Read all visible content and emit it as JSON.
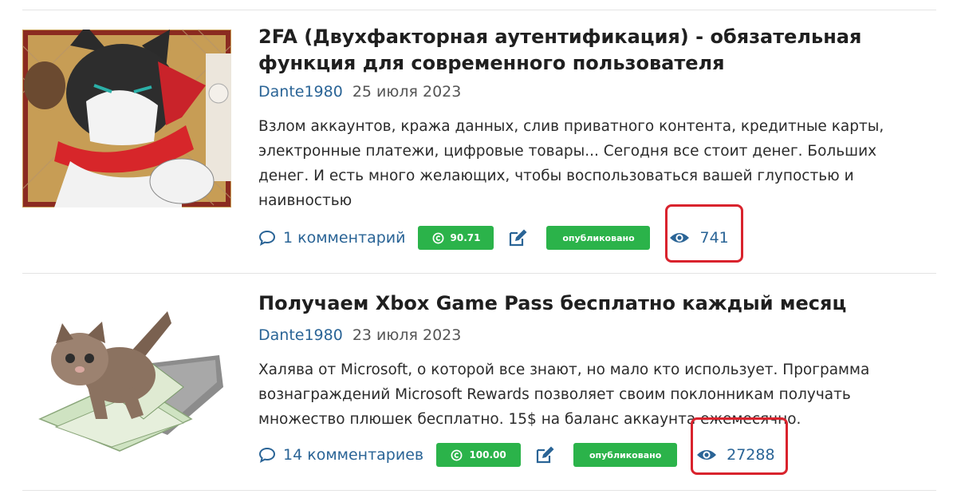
{
  "articles": [
    {
      "title": "2FA (Двухфакторная аутентификация) - обязательная функция для современного пользователя",
      "author": "Dante1980",
      "date": "25 июля 2023",
      "excerpt": "Взлом аккаунтов, кража данных, слив приватного контента, кредитные карты, электронные платежи, цифровые товары... Сегодня все стоит денег. Больших денег. И есть много желающих, чтобы воспользоваться вашей глупостью и наивностью",
      "comments": "1 комментарий",
      "score": "90.71",
      "status": "опубликовано",
      "views": "741",
      "thumbnail": "cat-with-red-scarf-illustration"
    },
    {
      "title": "Получаем Xbox Game Pass бесплатно каждый месяц",
      "author": "Dante1980",
      "date": "23 июля 2023",
      "excerpt": "Халява от Microsoft, о которой все знают, но мало кто использует. Программа вознаграждений Microsoft Rewards позволяет своим поклонникам получать множество плюшек бесплатно. 15$ на баланс аккаунта ежемесячно.",
      "comments": "14 комментариев",
      "score": "100.00",
      "status": "опубликовано",
      "views": "27288",
      "thumbnail": "kitten-with-money-photo"
    }
  ],
  "colors": {
    "link": "#2a6496",
    "badge_green": "#2bb34a",
    "highlight_red": "#d9232d"
  },
  "icons": [
    "comment-icon",
    "copyright-icon",
    "edit-icon",
    "eye-icon"
  ]
}
